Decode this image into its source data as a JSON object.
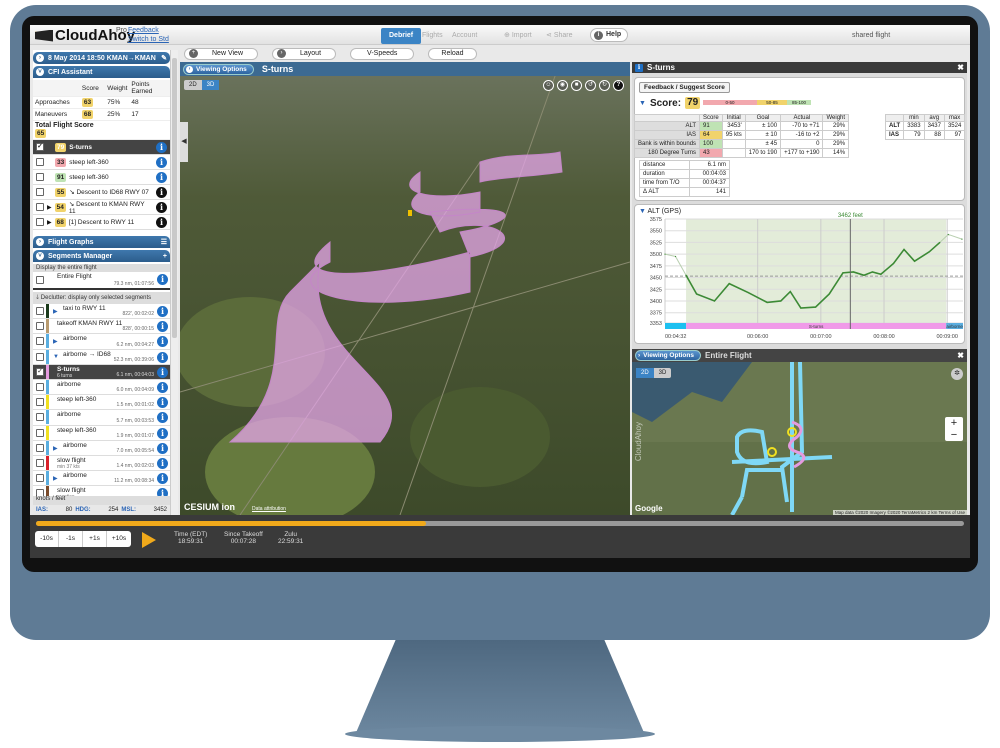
{
  "app": {
    "name": "CloudAhoy",
    "edition": "Pro",
    "feedback": "Feedback",
    "switch": "Switch to Std",
    "shared": "shared flight"
  },
  "nav": {
    "tabs": [
      {
        "label": "Debrief",
        "active": true
      },
      {
        "label": "Flights"
      },
      {
        "label": "Account"
      },
      {
        "label": "Import"
      },
      {
        "label": "Share"
      }
    ],
    "help": "Help"
  },
  "toolbar": {
    "new_view": "New View",
    "layout": "Layout",
    "vspeeds": "V-Speeds",
    "reload": "Reload"
  },
  "sidebar": {
    "flight_header": "8 May 2014 18:50  KMAN→KMAN",
    "cfi": {
      "title": "CFI Assistant",
      "cols": [
        "Score",
        "Weight",
        "Points Earned"
      ],
      "rows": [
        {
          "label": "Approaches",
          "score": "63",
          "weight": "75%",
          "points": "48"
        },
        {
          "label": "Maneuvers",
          "score": "68",
          "weight": "25%",
          "points": "17"
        }
      ],
      "total_label": "Total Flight Score",
      "total": "65",
      "segments": [
        {
          "score": "79",
          "name": "S-turns",
          "color": "y",
          "selected": true
        },
        {
          "score": "33",
          "name": "steep left-360",
          "color": "r"
        },
        {
          "score": "91",
          "name": "steep left-360",
          "color": "g"
        },
        {
          "score": "55",
          "name": "↘ Descent to ID68 RWY 07",
          "color": "y"
        },
        {
          "score": "54",
          "name": "↘ Descent to KMAN RWY 11",
          "color": "y",
          "expand": true
        },
        {
          "score": "68",
          "name": "[1] Descent to RWY 11",
          "color": "y",
          "expand": true
        }
      ]
    },
    "graphs_title": "Flight Graphs",
    "segments_manager": {
      "title": "Segments Manager",
      "display_all": "Display the entire flight",
      "entire": {
        "name": "Entire Flight",
        "stats": "79.3 nm, 01:07:56"
      },
      "declutter": "Declutter: display only selected segments",
      "items": [
        {
          "name": "taxi to RWY 11",
          "stats": "822', 00:02:02",
          "color": "#1b3a1b",
          "arrow": "▶"
        },
        {
          "name": "takeoff KMAN RWY 11",
          "stats": "828', 00:00:15",
          "color": "#b89a6e"
        },
        {
          "name": "airborne",
          "stats": "6.2 nm, 00:04:27",
          "color": "#5aaee0",
          "arrow": "▶"
        },
        {
          "name": "airborne → ID68",
          "stats": "52.3 nm, 00:39:06",
          "color": "#5aaee0",
          "arrow": "▼"
        },
        {
          "name": "S-turns",
          "sub": "6 turns",
          "stats": "6.1 nm, 00:04:03",
          "color": "#e59be0",
          "selected": true
        },
        {
          "name": "airborne",
          "stats": "6.0 nm, 00:04:09",
          "color": "#5aaee0"
        },
        {
          "name": "steep left-360",
          "stats": "1.5 nm, 00:01:02",
          "color": "#f0e020"
        },
        {
          "name": "airborne",
          "stats": "5.7 nm, 00:03:53",
          "color": "#5aaee0"
        },
        {
          "name": "steep left-360",
          "stats": "1.9 nm, 00:01:07",
          "color": "#f0e020"
        },
        {
          "name": "airborne",
          "stats": "7.0 nm, 00:05:54",
          "color": "#5aaee0",
          "arrow": "▶"
        },
        {
          "name": "slow flight",
          "sub": "min 37 kts",
          "stats": "1.4 nm, 00:02:03",
          "color": "#d8202a"
        },
        {
          "name": "airborne",
          "stats": "11.2 nm, 00:08:34",
          "color": "#5aaee0",
          "arrow": "▶"
        },
        {
          "name": "slow flight",
          "sub": "practice",
          "stats": "",
          "color": "#7a4a2a"
        }
      ]
    },
    "units": "knots / feet",
    "readout": {
      "ias_label": "IAS:",
      "ias": "80",
      "hdg_label": "HDG:",
      "hdg": "254",
      "msl_label": "MSL:",
      "msl": "3452"
    }
  },
  "view3d": {
    "viewing_options": "Viewing Options",
    "title": "S-turns",
    "mode_2d": "2D",
    "mode_3d": "3D",
    "help": "?",
    "cesium": "CESIUM ion",
    "attribution": "Data attribution"
  },
  "score_panel": {
    "title": "S-turns",
    "feedback": "Feedback / Suggest Score",
    "score_label": "Score:",
    "score": "79",
    "bands": [
      {
        "label": "0-50",
        "color": "#f2a8ae"
      },
      {
        "label": "50-85",
        "color": "#f1d36b"
      },
      {
        "label": "85-100",
        "color": "#bfe3b4"
      }
    ],
    "cols": [
      "",
      "Score",
      "Initial",
      "Goal",
      "Actual",
      "Weight"
    ],
    "rows": [
      {
        "label": "ALT",
        "score": "91",
        "c": "g",
        "initial": "3453'",
        "goal": "± 100",
        "actual": "-70 to +71",
        "weight": "29%"
      },
      {
        "label": "IAS",
        "score": "64",
        "c": "y",
        "initial": "95 kts",
        "goal": "± 10",
        "actual": "-16 to +2",
        "weight": "29%"
      },
      {
        "label": "Bank is within bounds",
        "score": "100",
        "c": "g",
        "initial": "",
        "goal": "± 45",
        "actual": "0",
        "weight": "29%"
      },
      {
        "label": "180 Degree Turns",
        "score": "43",
        "c": "r",
        "initial": "",
        "goal": "170 to 190",
        "actual": "+177 to +190",
        "weight": "14%"
      }
    ],
    "stats": [
      {
        "k": "distance",
        "v": "6.1 nm"
      },
      {
        "k": "duration",
        "v": "00:04:03"
      },
      {
        "k": "time from T/O",
        "v": "00:04:37"
      },
      {
        "k": "Δ ALT",
        "v": "141"
      }
    ],
    "mma": {
      "cols": [
        "",
        "min",
        "avg",
        "max"
      ],
      "rows": [
        [
          "ALT",
          "3383",
          "3437",
          "3524"
        ],
        [
          "IAS",
          "79",
          "88",
          "97"
        ]
      ]
    }
  },
  "chart_data": {
    "type": "line",
    "title": "ALT (GPS)",
    "xlabel": "",
    "ylabel": "",
    "ylim": [
      3353,
      3575
    ],
    "yticks": [
      3353,
      3375,
      3400,
      3425,
      3450,
      3475,
      3500,
      3525,
      3550,
      3575
    ],
    "xlim": [
      "00:04:32",
      "00:09:15"
    ],
    "xticks": [
      "00:04:32",
      "00:06:00",
      "00:07:00",
      "00:08:00",
      "00:09:00"
    ],
    "cursor": {
      "time": "00:07:28",
      "label": "3462 feet"
    },
    "reference": 3453,
    "segments": [
      {
        "label": "",
        "from": "00:04:32",
        "to": "00:04:52",
        "color": "#1ec0f0"
      },
      {
        "label": "S-turns",
        "from": "00:04:52",
        "to": "00:08:59",
        "color": "#f09ae8"
      },
      {
        "label": "airborne",
        "from": "00:08:59",
        "to": "00:09:15",
        "color": "#5aaee0"
      }
    ],
    "series": [
      {
        "x": [
          "00:04:32",
          "00:04:42",
          "00:04:52",
          "00:05:02",
          "00:05:19",
          "00:05:33",
          "00:05:51",
          "00:06:09",
          "00:06:22",
          "00:06:31",
          "00:06:41",
          "00:06:55",
          "00:07:08",
          "00:07:21",
          "00:07:31",
          "00:07:41",
          "00:07:49",
          "00:07:57",
          "00:08:09",
          "00:08:19",
          "00:08:29",
          "00:08:43",
          "00:08:53",
          "00:09:01",
          "00:09:14"
        ],
        "y": [
          3500,
          3495,
          3455,
          3415,
          3400,
          3437,
          3418,
          3397,
          3400,
          3420,
          3385,
          3387,
          3415,
          3460,
          3462,
          3455,
          3462,
          3457,
          3480,
          3510,
          3485,
          3505,
          3525,
          3542,
          3532
        ]
      }
    ]
  },
  "map": {
    "viewing_options": "Viewing Options",
    "title": "Entire Flight",
    "mode_2d": "2D",
    "mode_3d": "3D",
    "zoom_in": "+",
    "zoom_out": "−",
    "google": "Google",
    "watermark": "CloudAhoy",
    "attribution": "Map data ©2020 Imagery ©2020 TerraMetrics  2 km  Terms of Use"
  },
  "playback": {
    "progress": 0.42,
    "steps": [
      "-10s",
      "-1s",
      "+1s",
      "+10s"
    ],
    "time_label": "Time (EDT)",
    "time": "18:59:31",
    "since_label": "Since Takeoff",
    "since": "00:07:28",
    "zulu_label": "Zulu",
    "zulu": "22:59:31"
  }
}
